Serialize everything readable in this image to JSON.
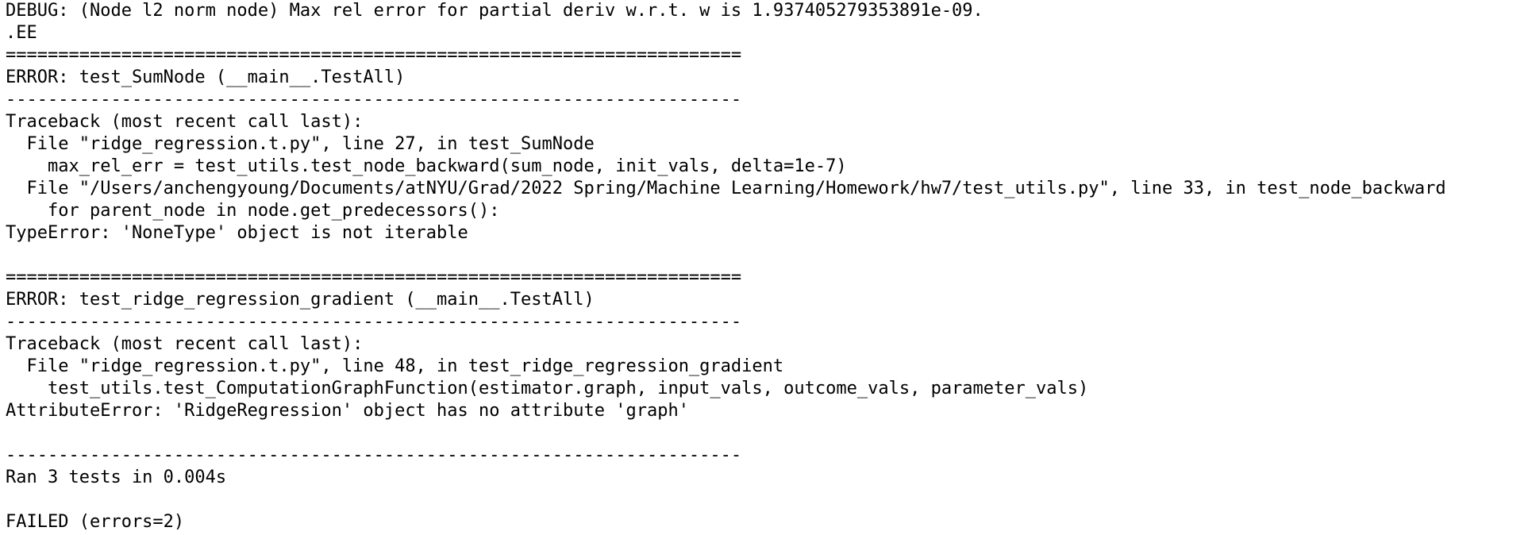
{
  "terminal": {
    "lines": [
      "DEBUG: (Node l2 norm node) Max rel error for partial deriv w.r.t. w is 1.937405279353891e-09.",
      ".EE",
      "======================================================================",
      "ERROR: test_SumNode (__main__.TestAll)",
      "----------------------------------------------------------------------",
      "Traceback (most recent call last):",
      "  File \"ridge_regression.t.py\", line 27, in test_SumNode",
      "    max_rel_err = test_utils.test_node_backward(sum_node, init_vals, delta=1e-7)",
      "  File \"/Users/anchengyoung/Documents/atNYU/Grad/2022 Spring/Machine Learning/Homework/hw7/test_utils.py\", line 33, in test_node_backward",
      "    for parent_node in node.get_predecessors():",
      "TypeError: 'NoneType' object is not iterable",
      "",
      "======================================================================",
      "ERROR: test_ridge_regression_gradient (__main__.TestAll)",
      "----------------------------------------------------------------------",
      "Traceback (most recent call last):",
      "  File \"ridge_regression.t.py\", line 48, in test_ridge_regression_gradient",
      "    test_utils.test_ComputationGraphFunction(estimator.graph, input_vals, outcome_vals, parameter_vals)",
      "AttributeError: 'RidgeRegression' object has no attribute 'graph'",
      "",
      "----------------------------------------------------------------------",
      "Ran 3 tests in 0.004s",
      "",
      "FAILED (errors=2)"
    ]
  }
}
